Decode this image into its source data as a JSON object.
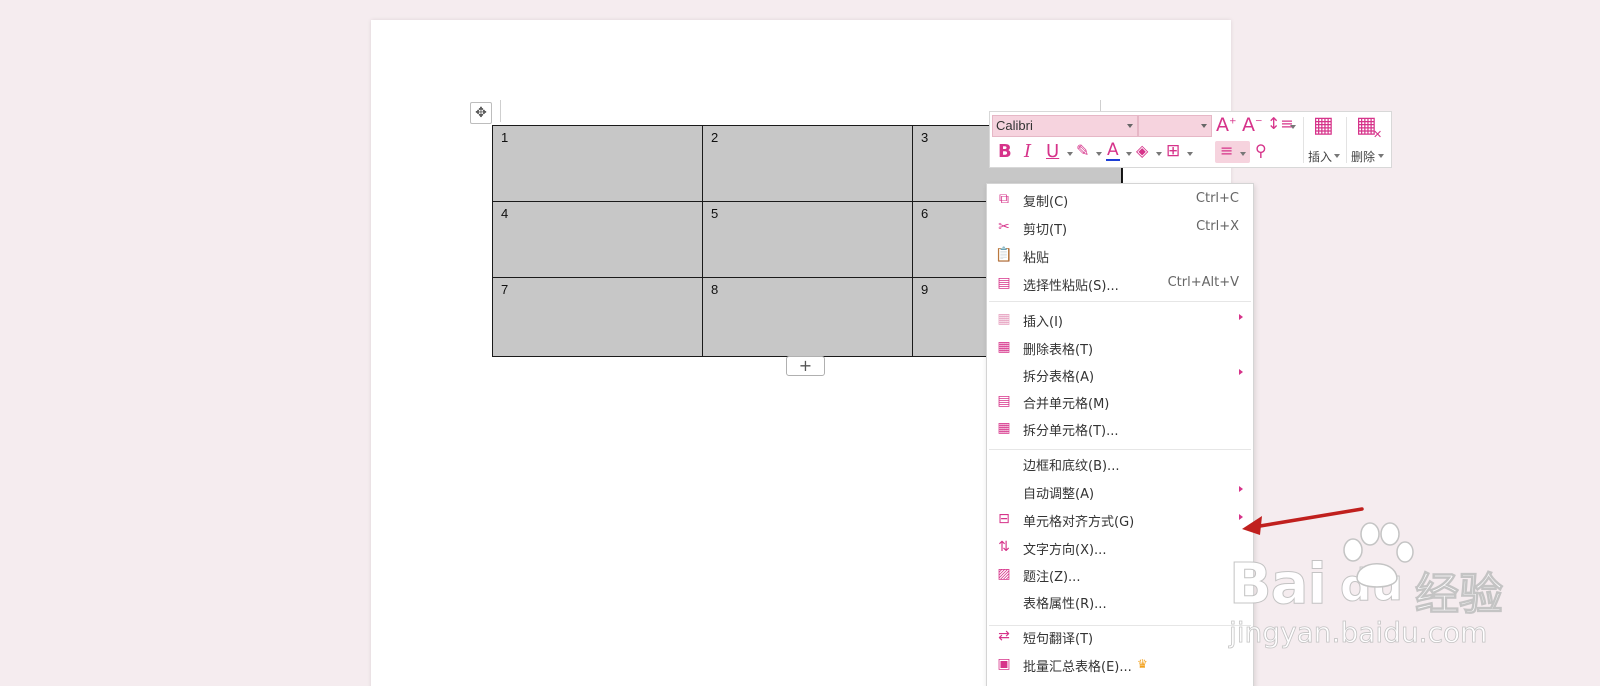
{
  "table": {
    "rows": [
      [
        "1",
        "2",
        "3"
      ],
      [
        "4",
        "5",
        "6"
      ],
      [
        "7",
        "8",
        "9"
      ]
    ],
    "add_row_label": "+"
  },
  "mini_toolbar": {
    "font_name": "Calibri",
    "font_size": "",
    "insert_label": "插入",
    "delete_label": "删除",
    "bold_glyph": "B",
    "italic_glyph": "I",
    "underline_glyph": "U",
    "font_color_glyph": "A",
    "grow_glyph": "A",
    "shrink_glyph": "A",
    "accent": "#d6338a",
    "icons": [
      "font-grow-icon",
      "font-shrink-icon",
      "line-spacing-icon",
      "bold-icon",
      "italic-icon",
      "underline-icon",
      "highlight-icon",
      "font-color-icon",
      "shading-icon",
      "borders-icon",
      "align-icon",
      "format-painter-icon",
      "insert-table-icon",
      "delete-table-icon"
    ]
  },
  "context_menu": {
    "items": [
      {
        "label": "复制(C)",
        "shortcut": "Ctrl+C",
        "icon": "copy-icon"
      },
      {
        "label": "剪切(T)",
        "shortcut": "Ctrl+X",
        "icon": "cut-icon"
      },
      {
        "label": "粘贴",
        "shortcut": "",
        "icon": "paste-icon"
      },
      {
        "label": "选择性粘贴(S)...",
        "shortcut": "Ctrl+Alt+V",
        "icon": "paste-special-icon"
      },
      {
        "label": "插入(I)",
        "shortcut": "",
        "icon": "insert-cells-icon",
        "submenu": true
      },
      {
        "label": "删除表格(T)",
        "shortcut": "",
        "icon": "delete-table-icon"
      },
      {
        "label": "拆分表格(A)",
        "shortcut": "",
        "icon": "",
        "submenu": true
      },
      {
        "label": "合并单元格(M)",
        "shortcut": "",
        "icon": "merge-cells-icon"
      },
      {
        "label": "拆分单元格(T)...",
        "shortcut": "",
        "icon": "split-cells-icon"
      },
      {
        "label": "边框和底纹(B)...",
        "shortcut": "",
        "icon": ""
      },
      {
        "label": "自动调整(A)",
        "shortcut": "",
        "icon": "",
        "submenu": true
      },
      {
        "label": "单元格对齐方式(G)",
        "shortcut": "",
        "icon": "cell-align-icon",
        "submenu": true
      },
      {
        "label": "文字方向(X)...",
        "shortcut": "",
        "icon": "text-direction-icon"
      },
      {
        "label": "题注(Z)...",
        "shortcut": "",
        "icon": "caption-icon"
      },
      {
        "label": "表格属性(R)...",
        "shortcut": "",
        "icon": ""
      },
      {
        "label": "短句翻译(T)",
        "shortcut": "",
        "icon": "translate-icon"
      },
      {
        "label": "批量汇总表格(E)...",
        "shortcut": "",
        "icon": "batch-summary-icon",
        "premium": true
      }
    ]
  },
  "watermark": {
    "brand": "Bai",
    "brand2": "du",
    "suffix": "经验",
    "url": "jingyan.baidu.com"
  },
  "colors": {
    "background": "#f5ecef",
    "accent": "#d6338a",
    "arrow": "#c0201e",
    "table_fill": "#c7c7c7"
  }
}
